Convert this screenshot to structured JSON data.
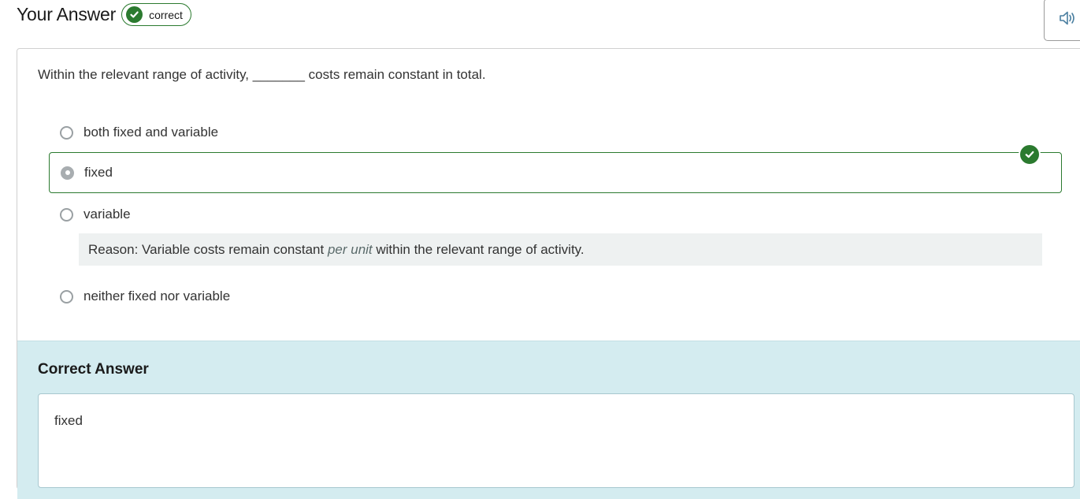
{
  "header": {
    "title": "Your Answer",
    "badge_label": "correct",
    "badge_icon": "check-circle-icon",
    "audio_icon": "speaker-icon"
  },
  "question": {
    "text": "Within the relevant range of activity, _______ costs remain constant in total."
  },
  "options": [
    {
      "label": "both fixed and variable",
      "selected": false
    },
    {
      "label": "fixed",
      "selected": true,
      "marked_correct": true
    },
    {
      "label": "variable",
      "selected": false
    },
    {
      "label": "neither fixed nor variable",
      "selected": false
    }
  ],
  "reason": {
    "prefix": "Reason: Variable costs remain constant ",
    "emphasis": "per unit",
    "suffix": " within the relevant range of activity."
  },
  "correct_answer": {
    "title": "Correct Answer",
    "value": "fixed"
  },
  "colors": {
    "correct_green": "#2b7a2f",
    "reason_bg": "#eef1f1",
    "correct_section_bg": "#d4ecf0"
  }
}
